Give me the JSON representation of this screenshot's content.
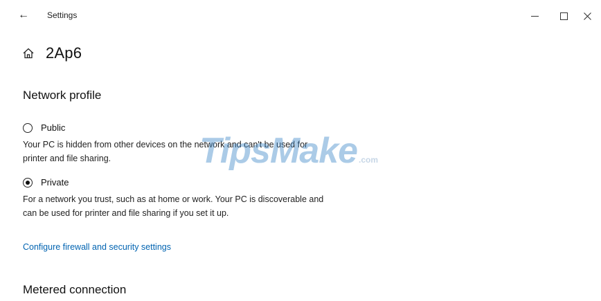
{
  "titlebar": {
    "back_icon": "back-arrow-icon",
    "app_title": "Settings",
    "controls": [
      "minimize-icon",
      "maximize-icon",
      "close-icon"
    ]
  },
  "header": {
    "icon": "home-icon",
    "title": "2Ap6"
  },
  "network_profile": {
    "heading": "Network profile",
    "options": [
      {
        "label": "Public",
        "selected": false,
        "description": "Your PC is hidden from other devices on the network and can't be used for printer and file sharing."
      },
      {
        "label": "Private",
        "selected": true,
        "description": "For a network you trust, such as at home or work. Your PC is discoverable and can be used for printer and file sharing if you set it up."
      }
    ],
    "link": "Configure firewall and security settings"
  },
  "metered": {
    "heading": "Metered connection"
  },
  "watermark": {
    "main": "TipsMake",
    "domain": ".com"
  },
  "colors": {
    "link": "#0063b1",
    "watermark": "#3a86c8"
  }
}
